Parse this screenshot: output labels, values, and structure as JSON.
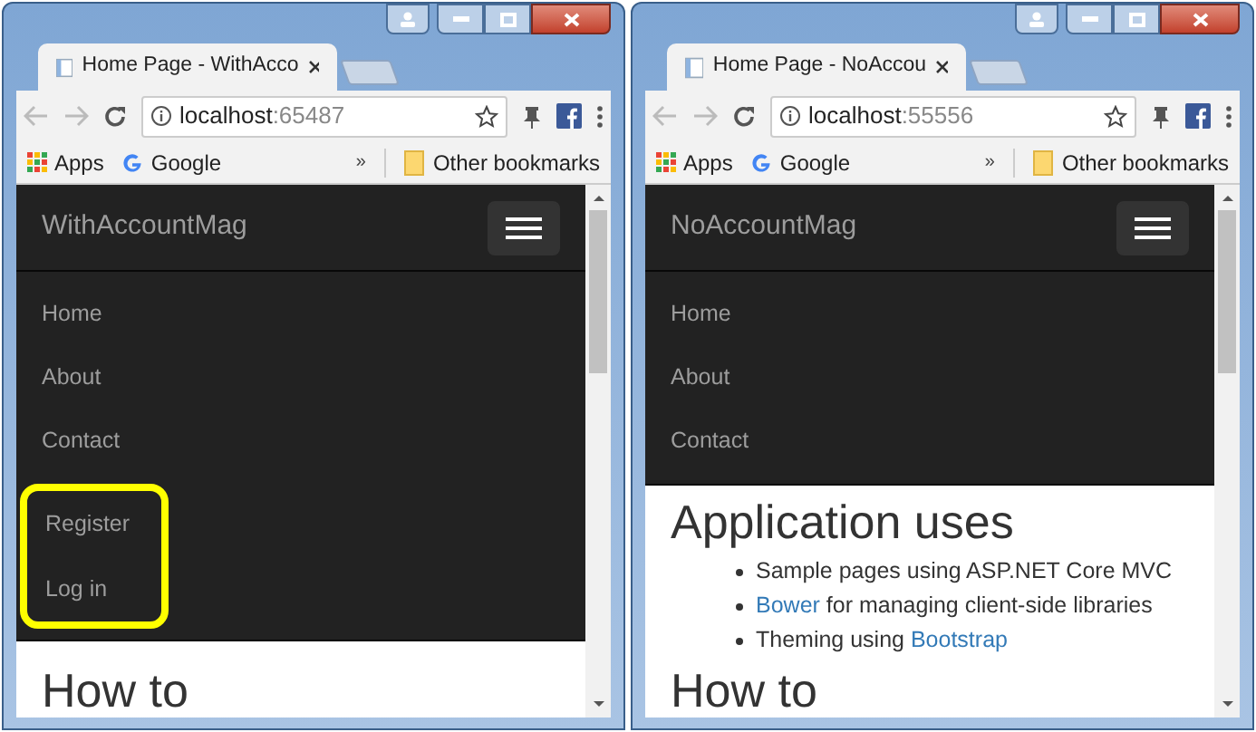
{
  "windows": [
    {
      "tab_title": "Home Page - WithAcco",
      "url_host": "localhost",
      "url_port": ":65487",
      "bookmarks": [
        {
          "label": "Apps",
          "kind": "apps"
        },
        {
          "label": "Google",
          "kind": "google"
        }
      ],
      "overflow": "»",
      "other_bookmarks": "Other bookmarks",
      "brand": "WithAccountMag",
      "nav_items": [
        {
          "label": "Home"
        },
        {
          "label": "About"
        },
        {
          "label": "Contact"
        }
      ],
      "account_items": {
        "highlighted": true,
        "items": [
          {
            "label": "Register"
          },
          {
            "label": "Log in"
          }
        ]
      },
      "sections": [
        {
          "heading": "How to"
        }
      ]
    },
    {
      "tab_title": "Home Page - NoAccou",
      "url_host": "localhost",
      "url_port": ":55556",
      "bookmarks": [
        {
          "label": "Apps",
          "kind": "apps"
        },
        {
          "label": "Google",
          "kind": "google"
        }
      ],
      "overflow": "»",
      "other_bookmarks": "Other bookmarks",
      "brand": "NoAccountMag",
      "nav_items": [
        {
          "label": "Home"
        },
        {
          "label": "About"
        },
        {
          "label": "Contact"
        }
      ],
      "sections": [
        {
          "heading": "Application uses",
          "items": [
            [
              {
                "text": "Sample pages using ASP.NET Core MVC",
                "link": false
              }
            ],
            [
              {
                "text": "Bower",
                "link": true
              },
              {
                "text": " for managing client-side libraries",
                "link": false
              }
            ],
            [
              {
                "text": "Theming using ",
                "link": false
              },
              {
                "text": "Bootstrap",
                "link": true
              }
            ]
          ]
        },
        {
          "heading": "How to"
        }
      ]
    }
  ]
}
